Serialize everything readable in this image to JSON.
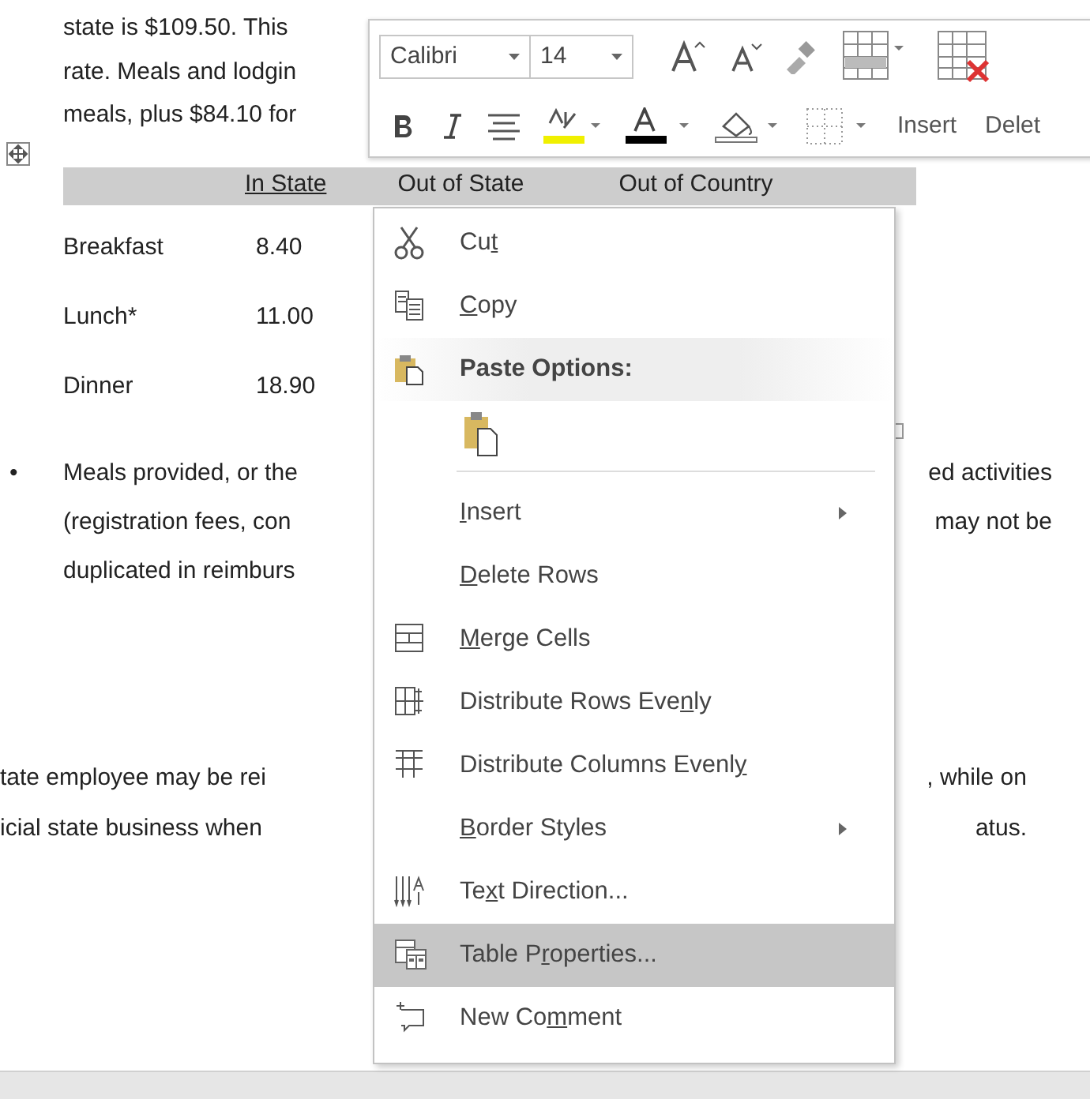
{
  "document": {
    "intro_lines": [
      "state is $109.50. This",
      "rate. Meals and lodgin",
      "meals, plus $84.10 for"
    ],
    "table": {
      "columns": [
        "In State",
        "Out of State",
        "Out of Country"
      ],
      "rows": [
        {
          "meal": "Breakfast",
          "in_state": "8.40"
        },
        {
          "meal": "Lunch*",
          "in_state": "11.00"
        },
        {
          "meal": "Dinner",
          "in_state": "18.90"
        }
      ]
    },
    "bullet": {
      "marker": "•",
      "lines": [
        {
          "left": "Meals provided, or the",
          "right": "ed activities"
        },
        {
          "left": "(registration fees, con",
          "right": "may not be"
        },
        {
          "left": "duplicated in reimburs"
        }
      ]
    },
    "closing_lines": [
      {
        "left": "tate employee may be rei",
        "right": ", while on"
      },
      {
        "left": "icial state business when",
        "right": "atus."
      }
    ]
  },
  "mini_toolbar": {
    "font": "Calibri",
    "size": "14",
    "insert_label": "Insert",
    "delete_label": "Delet"
  },
  "context_menu": [
    {
      "kind": "command",
      "before": "Cu",
      "key": "t",
      "selected": false,
      "submenu": false
    },
    {
      "kind": "command",
      "key": "C",
      "after": "opy",
      "selected": false,
      "submenu": false
    },
    {
      "kind": "header",
      "after": "Paste Options:"
    },
    {
      "kind": "paste-options"
    },
    {
      "kind": "separator"
    },
    {
      "kind": "command",
      "key": "I",
      "after": "nsert",
      "selected": false,
      "submenu": true
    },
    {
      "kind": "command",
      "key": "D",
      "after": "elete Rows",
      "selected": false,
      "submenu": false
    },
    {
      "kind": "command",
      "key": "M",
      "after": "erge Cells",
      "selected": false,
      "submenu": false
    },
    {
      "kind": "command",
      "before": "Distribute Rows Eve",
      "key": "n",
      "after": "ly",
      "selected": false,
      "submenu": false
    },
    {
      "kind": "command",
      "before": "Distribute Columns Evenl",
      "key": "y",
      "selected": false,
      "submenu": false
    },
    {
      "kind": "command",
      "key": "B",
      "after": "order Styles",
      "selected": false,
      "submenu": true
    },
    {
      "kind": "command",
      "before": "Te",
      "key": "x",
      "after": "t Direction...",
      "selected": false,
      "submenu": false
    },
    {
      "kind": "command",
      "before": "Table P",
      "key": "r",
      "after": "operties...",
      "selected": true,
      "submenu": false
    },
    {
      "kind": "command",
      "before": "New Co",
      "key": "m",
      "after": "ment",
      "selected": false,
      "submenu": false
    }
  ]
}
